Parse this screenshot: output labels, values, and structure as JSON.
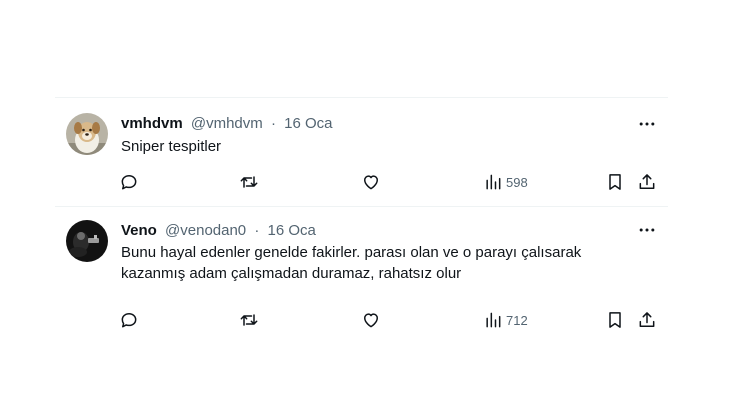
{
  "tweets": [
    {
      "name": "vmhdvm",
      "handle": "@vmhdvm",
      "separator": "·",
      "date": "16 Oca",
      "text": "Sniper tespitler",
      "views": "598",
      "avatar": "dog-avatar"
    },
    {
      "name": "Veno",
      "handle": "@venodan0",
      "separator": "·",
      "date": "16 Oca",
      "text": "Bunu hayal edenler genelde fakirler. parası olan ve o parayı çalısarak kazanmış adam çalışmadan duramaz, rahatsız olur",
      "views": "712",
      "avatar": "dark-avatar"
    }
  ],
  "icons": {
    "more": "more-dots-icon",
    "reply": "reply-icon",
    "retweet": "retweet-icon",
    "like": "heart-icon",
    "views": "views-bar-chart-icon",
    "bookmark": "bookmark-icon",
    "share": "share-icon"
  },
  "colors": {
    "text": "#0f1419",
    "secondary": "#536471",
    "divider": "#eff3f4"
  }
}
